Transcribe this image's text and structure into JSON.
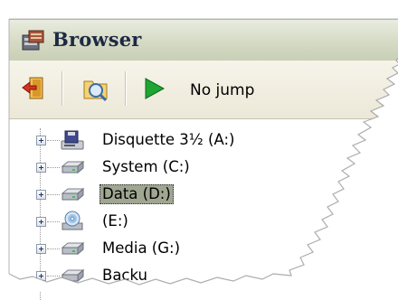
{
  "window": {
    "title": "Browser"
  },
  "toolbar": {
    "exit_icon": "exit-door-icon",
    "search_icon": "folder-search-icon",
    "play_icon": "play-icon",
    "jump_label": "No jump"
  },
  "tree": {
    "items": [
      {
        "label": "Disquette 3½ (A:)",
        "icon": "floppy-drive-icon",
        "selected": false
      },
      {
        "label": "System (C:)",
        "icon": "hard-drive-icon",
        "selected": false
      },
      {
        "label": "Data (D:)",
        "icon": "hard-drive-icon",
        "selected": true
      },
      {
        "label": "(E:)",
        "icon": "cd-drive-icon",
        "selected": false
      },
      {
        "label": "Media (G:)",
        "icon": "hard-drive-icon",
        "selected": false
      },
      {
        "label": "Backu",
        "icon": "hard-drive-icon",
        "selected": false
      }
    ]
  },
  "colors": {
    "title_text": "#1e2a44",
    "selection_bg": "#9fa691",
    "play_green": "#1fa531"
  }
}
